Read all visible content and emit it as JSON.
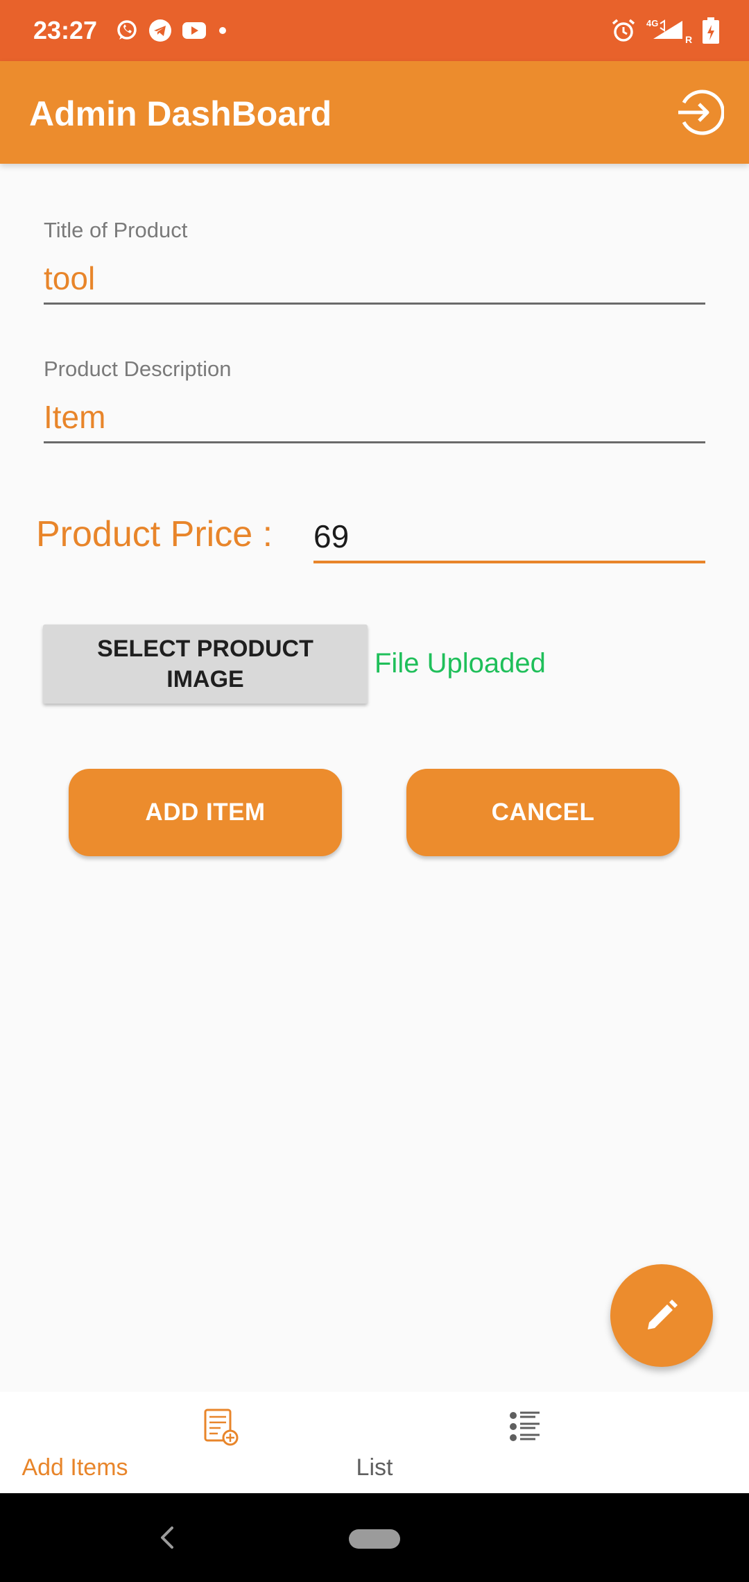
{
  "status_bar": {
    "time": "23:27",
    "notification_icons": [
      "whatsapp-icon",
      "telegram-icon",
      "youtube-icon",
      "dot-icon"
    ],
    "system_icons": [
      "alarm-icon",
      "4g-signal-icon",
      "battery-charging-icon"
    ],
    "network_label": "4G",
    "roaming_label": "R"
  },
  "app_bar": {
    "title": "Admin DashBoard",
    "action_icon": "logout-icon"
  },
  "form": {
    "title_field": {
      "label": "Title of Product",
      "value": "tool"
    },
    "description_field": {
      "label": "Product Description",
      "value": "Item"
    },
    "price": {
      "label": "Product Price :",
      "value": "69"
    },
    "select_image_button": "SELECT PRODUCT\nIMAGE",
    "upload_status": "File Uploaded",
    "add_button": "ADD ITEM",
    "cancel_button": "CANCEL"
  },
  "fab": {
    "icon": "pencil-icon"
  },
  "bottom_nav": {
    "items": [
      {
        "label": "Add Items",
        "icon": "add-items-icon",
        "active": true
      },
      {
        "label": "List",
        "icon": "list-icon",
        "active": false
      }
    ]
  },
  "colors": {
    "status_bar": "#e8622b",
    "app_bar": "#ec8c2d",
    "accent": "#e8852a",
    "success": "#1fbf5a",
    "inactive": "#5f5f5f"
  }
}
